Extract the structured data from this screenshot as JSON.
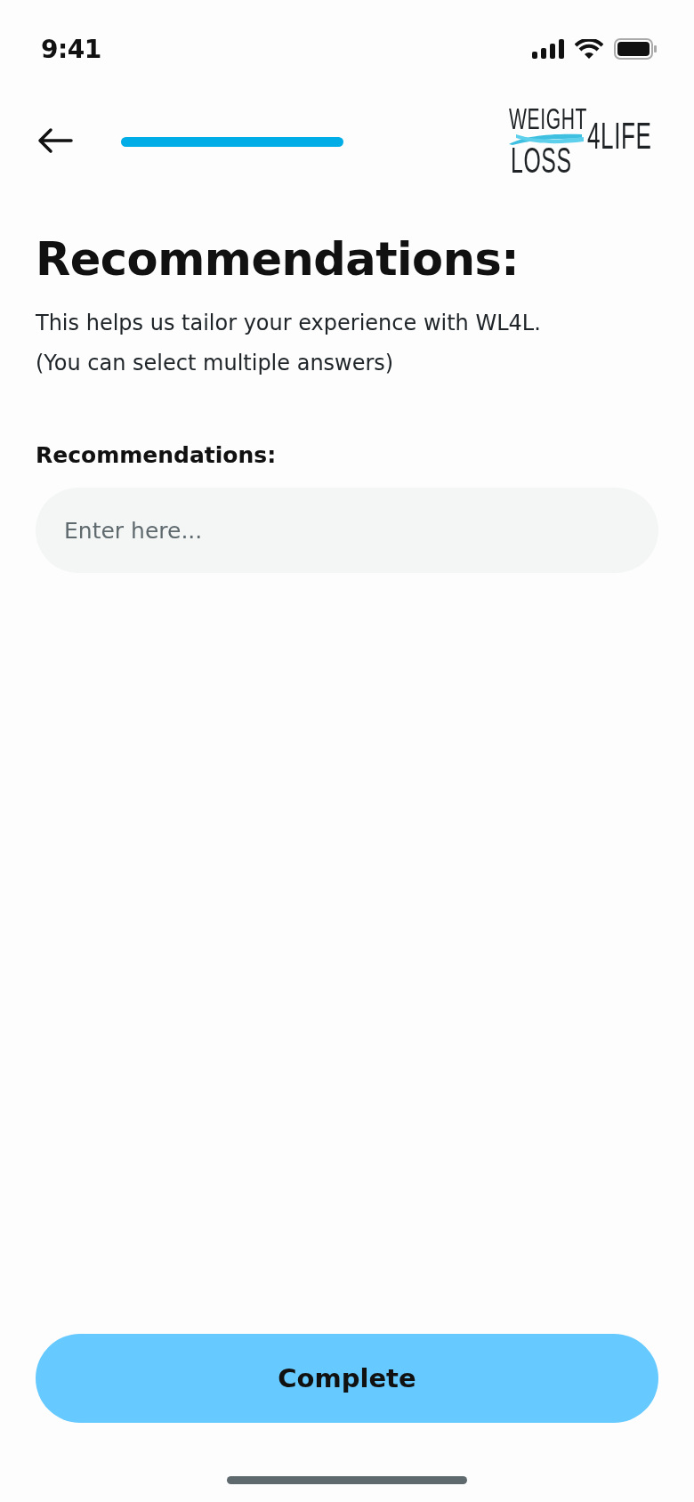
{
  "status_bar": {
    "time": "9:41"
  },
  "header": {
    "logo": {
      "top": "WEIGHT",
      "bottom": "LOSS",
      "side": "4LIFE"
    }
  },
  "title": "Recommendations:",
  "description": [
    "This helps us tailor your experience with WL4L.",
    "(You can select multiple answers)"
  ],
  "field": {
    "label": "Recommendations:",
    "placeholder": "Enter here..."
  },
  "button": {
    "label": "Complete"
  }
}
